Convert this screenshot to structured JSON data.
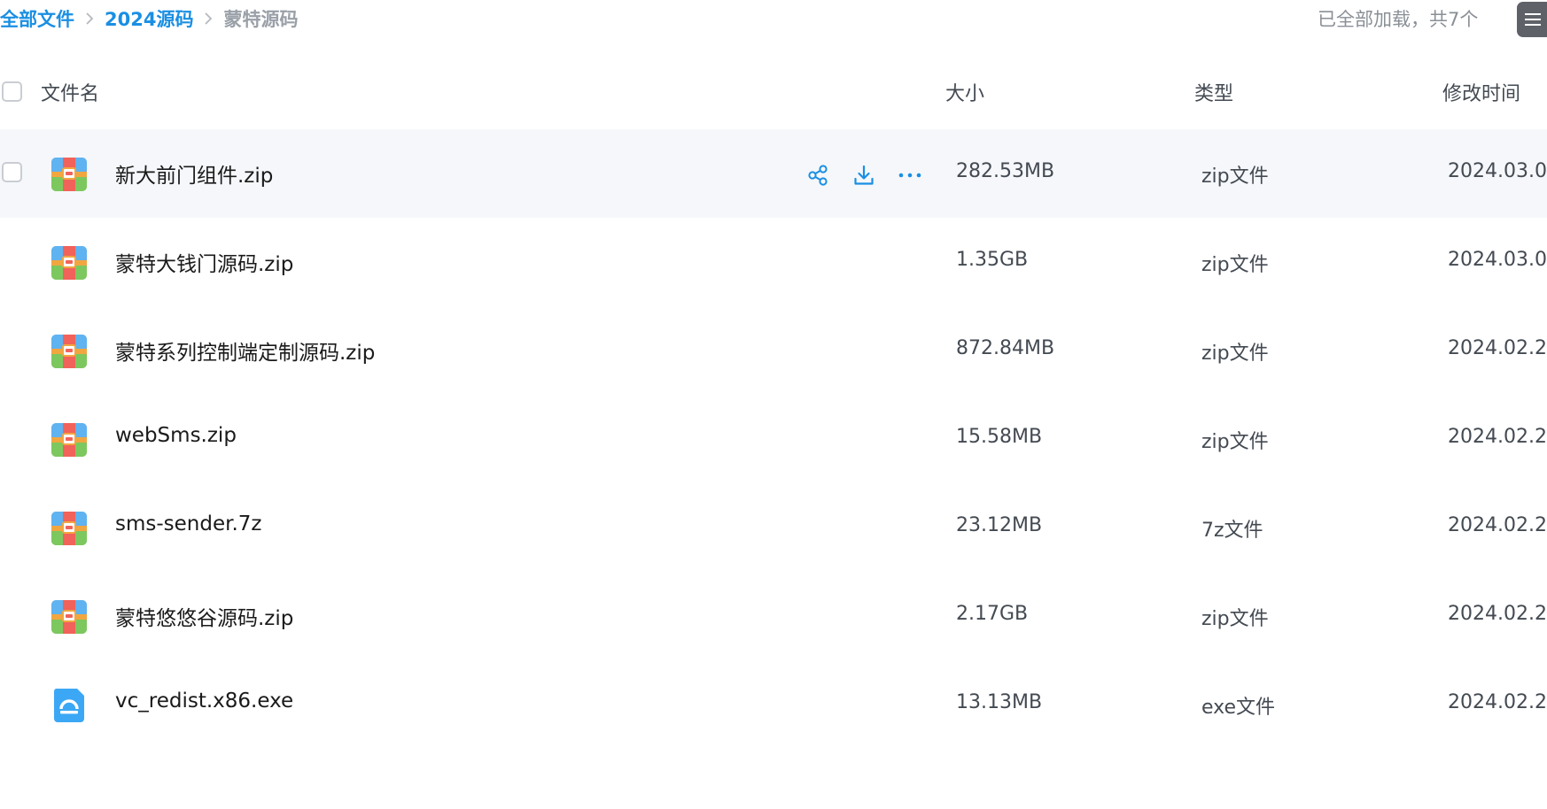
{
  "breadcrumb": {
    "items": [
      "全部文件",
      "2024源码"
    ],
    "current": "蒙特源码"
  },
  "load_status": "已全部加载，共7个",
  "header": {
    "name": "文件名",
    "size": "大小",
    "type": "类型",
    "modified": "修改时间"
  },
  "icons": {
    "archive": "zip-archive-icon",
    "exe": "executable-icon",
    "share": "share-icon",
    "download": "download-icon",
    "more": "more-icon",
    "view_toggle": "list-view-icon"
  },
  "colors": {
    "accent": "#1a8fe3",
    "row_hover": "#f5f7fa",
    "archive_red": "#f0625a",
    "archive_green": "#7cc85f",
    "archive_blue": "#5fb3f0",
    "archive_strap": "#f2a640",
    "exe_blue": "#3ca8f5"
  },
  "files": [
    {
      "name": "新大前门组件.zip",
      "size": "282.53MB",
      "type": "zip文件",
      "modified": "2024.03.0",
      "icon": "archive",
      "active": true
    },
    {
      "name": "蒙特大钱门源码.zip",
      "size": "1.35GB",
      "type": "zip文件",
      "modified": "2024.03.0",
      "icon": "archive",
      "active": false
    },
    {
      "name": "蒙特系列控制端定制源码.zip",
      "size": "872.84MB",
      "type": "zip文件",
      "modified": "2024.02.2",
      "icon": "archive",
      "active": false
    },
    {
      "name": "webSms.zip",
      "size": "15.58MB",
      "type": "zip文件",
      "modified": "2024.02.2",
      "icon": "archive",
      "active": false
    },
    {
      "name": "sms-sender.7z",
      "size": "23.12MB",
      "type": "7z文件",
      "modified": "2024.02.2",
      "icon": "archive",
      "active": false
    },
    {
      "name": "蒙特悠悠谷源码.zip",
      "size": "2.17GB",
      "type": "zip文件",
      "modified": "2024.02.2",
      "icon": "archive",
      "active": false
    },
    {
      "name": "vc_redist.x86.exe",
      "size": "13.13MB",
      "type": "exe文件",
      "modified": "2024.02.2",
      "icon": "exe",
      "active": false
    }
  ]
}
